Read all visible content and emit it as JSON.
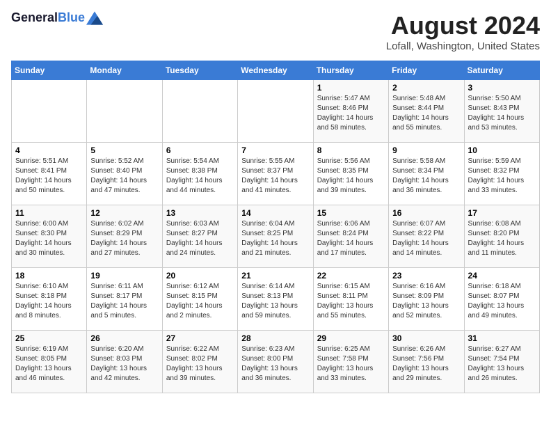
{
  "header": {
    "logo_line1": "General",
    "logo_line2": "Blue",
    "title": "August 2024",
    "subtitle": "Lofall, Washington, United States"
  },
  "days_of_week": [
    "Sunday",
    "Monday",
    "Tuesday",
    "Wednesday",
    "Thursday",
    "Friday",
    "Saturday"
  ],
  "weeks": [
    [
      {
        "day": "",
        "sunrise": "",
        "sunset": "",
        "daylight": ""
      },
      {
        "day": "",
        "sunrise": "",
        "sunset": "",
        "daylight": ""
      },
      {
        "day": "",
        "sunrise": "",
        "sunset": "",
        "daylight": ""
      },
      {
        "day": "",
        "sunrise": "",
        "sunset": "",
        "daylight": ""
      },
      {
        "day": "1",
        "sunrise": "Sunrise: 5:47 AM",
        "sunset": "Sunset: 8:46 PM",
        "daylight": "Daylight: 14 hours and 58 minutes."
      },
      {
        "day": "2",
        "sunrise": "Sunrise: 5:48 AM",
        "sunset": "Sunset: 8:44 PM",
        "daylight": "Daylight: 14 hours and 55 minutes."
      },
      {
        "day": "3",
        "sunrise": "Sunrise: 5:50 AM",
        "sunset": "Sunset: 8:43 PM",
        "daylight": "Daylight: 14 hours and 53 minutes."
      }
    ],
    [
      {
        "day": "4",
        "sunrise": "Sunrise: 5:51 AM",
        "sunset": "Sunset: 8:41 PM",
        "daylight": "Daylight: 14 hours and 50 minutes."
      },
      {
        "day": "5",
        "sunrise": "Sunrise: 5:52 AM",
        "sunset": "Sunset: 8:40 PM",
        "daylight": "Daylight: 14 hours and 47 minutes."
      },
      {
        "day": "6",
        "sunrise": "Sunrise: 5:54 AM",
        "sunset": "Sunset: 8:38 PM",
        "daylight": "Daylight: 14 hours and 44 minutes."
      },
      {
        "day": "7",
        "sunrise": "Sunrise: 5:55 AM",
        "sunset": "Sunset: 8:37 PM",
        "daylight": "Daylight: 14 hours and 41 minutes."
      },
      {
        "day": "8",
        "sunrise": "Sunrise: 5:56 AM",
        "sunset": "Sunset: 8:35 PM",
        "daylight": "Daylight: 14 hours and 39 minutes."
      },
      {
        "day": "9",
        "sunrise": "Sunrise: 5:58 AM",
        "sunset": "Sunset: 8:34 PM",
        "daylight": "Daylight: 14 hours and 36 minutes."
      },
      {
        "day": "10",
        "sunrise": "Sunrise: 5:59 AM",
        "sunset": "Sunset: 8:32 PM",
        "daylight": "Daylight: 14 hours and 33 minutes."
      }
    ],
    [
      {
        "day": "11",
        "sunrise": "Sunrise: 6:00 AM",
        "sunset": "Sunset: 8:30 PM",
        "daylight": "Daylight: 14 hours and 30 minutes."
      },
      {
        "day": "12",
        "sunrise": "Sunrise: 6:02 AM",
        "sunset": "Sunset: 8:29 PM",
        "daylight": "Daylight: 14 hours and 27 minutes."
      },
      {
        "day": "13",
        "sunrise": "Sunrise: 6:03 AM",
        "sunset": "Sunset: 8:27 PM",
        "daylight": "Daylight: 14 hours and 24 minutes."
      },
      {
        "day": "14",
        "sunrise": "Sunrise: 6:04 AM",
        "sunset": "Sunset: 8:25 PM",
        "daylight": "Daylight: 14 hours and 21 minutes."
      },
      {
        "day": "15",
        "sunrise": "Sunrise: 6:06 AM",
        "sunset": "Sunset: 8:24 PM",
        "daylight": "Daylight: 14 hours and 17 minutes."
      },
      {
        "day": "16",
        "sunrise": "Sunrise: 6:07 AM",
        "sunset": "Sunset: 8:22 PM",
        "daylight": "Daylight: 14 hours and 14 minutes."
      },
      {
        "day": "17",
        "sunrise": "Sunrise: 6:08 AM",
        "sunset": "Sunset: 8:20 PM",
        "daylight": "Daylight: 14 hours and 11 minutes."
      }
    ],
    [
      {
        "day": "18",
        "sunrise": "Sunrise: 6:10 AM",
        "sunset": "Sunset: 8:18 PM",
        "daylight": "Daylight: 14 hours and 8 minutes."
      },
      {
        "day": "19",
        "sunrise": "Sunrise: 6:11 AM",
        "sunset": "Sunset: 8:17 PM",
        "daylight": "Daylight: 14 hours and 5 minutes."
      },
      {
        "day": "20",
        "sunrise": "Sunrise: 6:12 AM",
        "sunset": "Sunset: 8:15 PM",
        "daylight": "Daylight: 14 hours and 2 minutes."
      },
      {
        "day": "21",
        "sunrise": "Sunrise: 6:14 AM",
        "sunset": "Sunset: 8:13 PM",
        "daylight": "Daylight: 13 hours and 59 minutes."
      },
      {
        "day": "22",
        "sunrise": "Sunrise: 6:15 AM",
        "sunset": "Sunset: 8:11 PM",
        "daylight": "Daylight: 13 hours and 55 minutes."
      },
      {
        "day": "23",
        "sunrise": "Sunrise: 6:16 AM",
        "sunset": "Sunset: 8:09 PM",
        "daylight": "Daylight: 13 hours and 52 minutes."
      },
      {
        "day": "24",
        "sunrise": "Sunrise: 6:18 AM",
        "sunset": "Sunset: 8:07 PM",
        "daylight": "Daylight: 13 hours and 49 minutes."
      }
    ],
    [
      {
        "day": "25",
        "sunrise": "Sunrise: 6:19 AM",
        "sunset": "Sunset: 8:05 PM",
        "daylight": "Daylight: 13 hours and 46 minutes."
      },
      {
        "day": "26",
        "sunrise": "Sunrise: 6:20 AM",
        "sunset": "Sunset: 8:03 PM",
        "daylight": "Daylight: 13 hours and 42 minutes."
      },
      {
        "day": "27",
        "sunrise": "Sunrise: 6:22 AM",
        "sunset": "Sunset: 8:02 PM",
        "daylight": "Daylight: 13 hours and 39 minutes."
      },
      {
        "day": "28",
        "sunrise": "Sunrise: 6:23 AM",
        "sunset": "Sunset: 8:00 PM",
        "daylight": "Daylight: 13 hours and 36 minutes."
      },
      {
        "day": "29",
        "sunrise": "Sunrise: 6:25 AM",
        "sunset": "Sunset: 7:58 PM",
        "daylight": "Daylight: 13 hours and 33 minutes."
      },
      {
        "day": "30",
        "sunrise": "Sunrise: 6:26 AM",
        "sunset": "Sunset: 7:56 PM",
        "daylight": "Daylight: 13 hours and 29 minutes."
      },
      {
        "day": "31",
        "sunrise": "Sunrise: 6:27 AM",
        "sunset": "Sunset: 7:54 PM",
        "daylight": "Daylight: 13 hours and 26 minutes."
      }
    ]
  ]
}
